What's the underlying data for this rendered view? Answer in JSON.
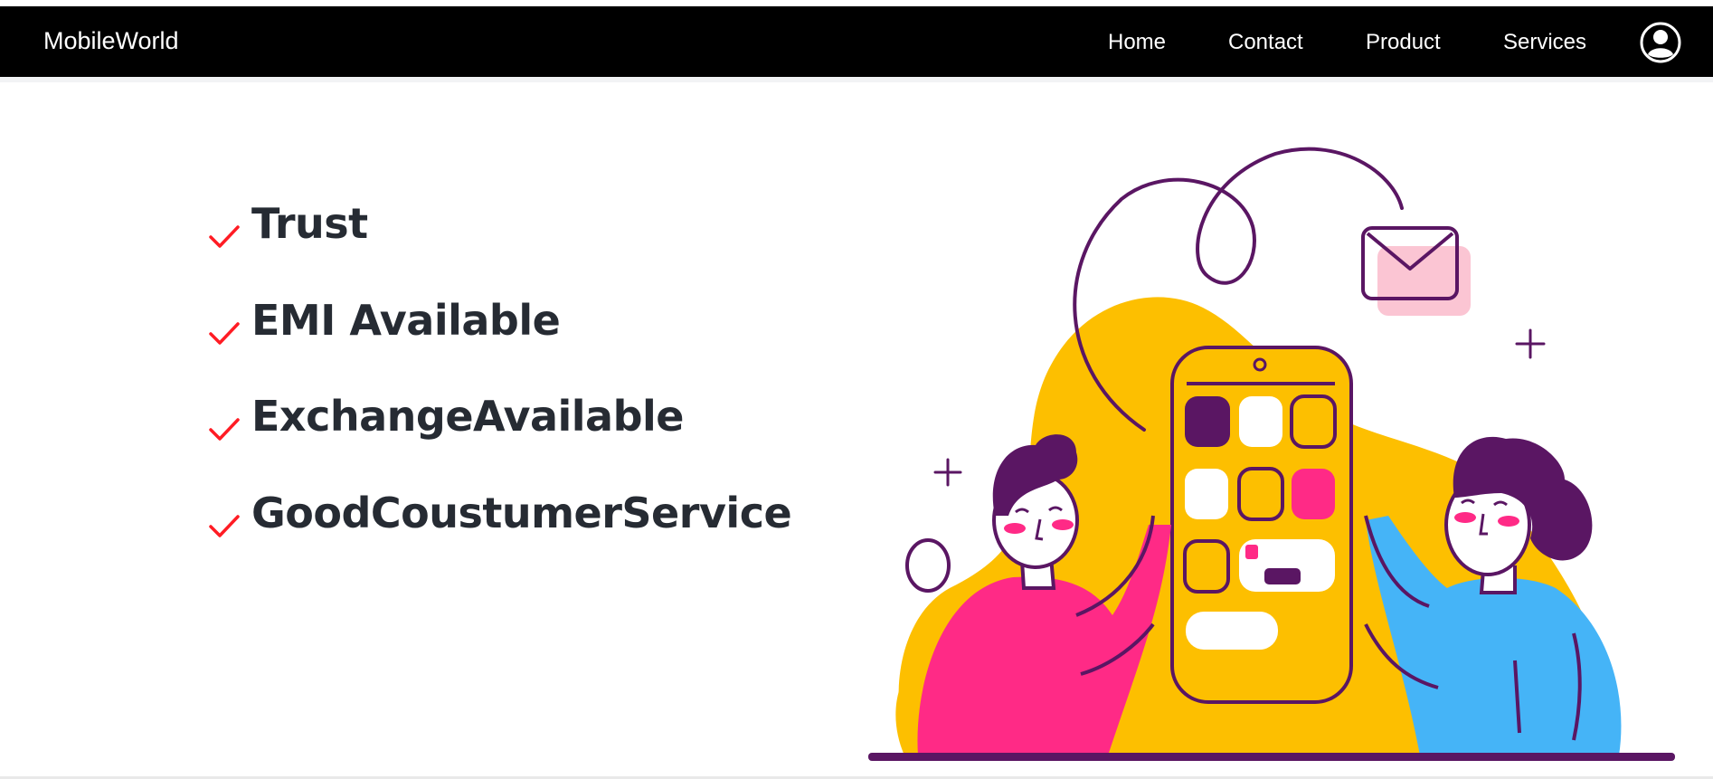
{
  "navbar": {
    "brand": "MobileWorld",
    "links": [
      {
        "label": "Home"
      },
      {
        "label": "Contact"
      },
      {
        "label": "Product"
      },
      {
        "label": "Services"
      }
    ],
    "account_icon": "user-circle-icon"
  },
  "features": [
    {
      "label": "Trust",
      "icon": "checkmark-icon"
    },
    {
      "label": "EMI Available",
      "icon": "checkmark-icon"
    },
    {
      "label": "ExchangeAvailable",
      "icon": "checkmark-icon"
    },
    {
      "label": "GoodCoustumerService",
      "icon": "checkmark-icon"
    }
  ],
  "illustration": {
    "subject": "two people holding a large smartphone with app tiles and an envelope",
    "colors": {
      "yellow": "#fdbf00",
      "pink": "#ff2a86",
      "blue": "#45b4f7",
      "purple": "#5a1663",
      "envelope_pink": "#fbc5d3"
    }
  },
  "colors": {
    "navbar_bg": "#000000",
    "check": "#ff1c24",
    "feature_text": "#262b33"
  }
}
